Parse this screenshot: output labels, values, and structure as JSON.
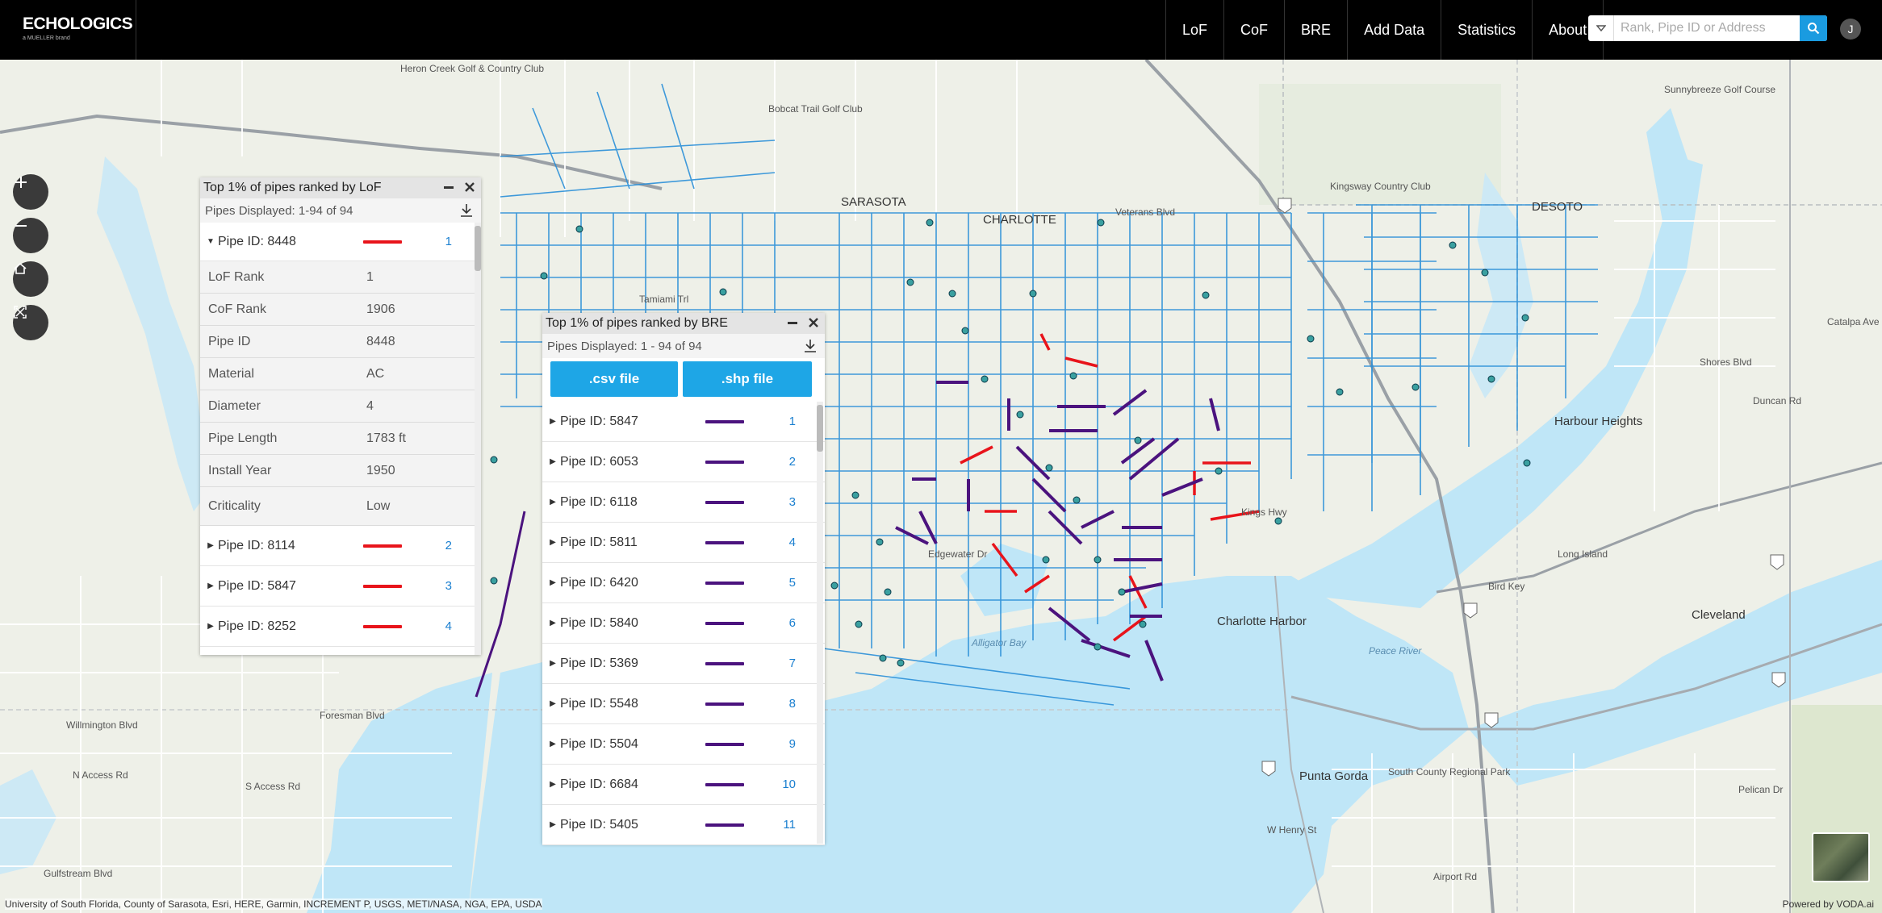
{
  "brand": {
    "name": "ECHOLOGICS",
    "sub": "a MUELLER brand"
  },
  "nav": [
    "LoF",
    "CoF",
    "BRE",
    "Add Data",
    "Statistics",
    "About"
  ],
  "search": {
    "placeholder": "Rank, Pipe ID or Address"
  },
  "user": {
    "initial": "J"
  },
  "map": {
    "labels": [
      {
        "text": "SARASOTA",
        "cls": "city"
      },
      {
        "text": "CHARLOTTE",
        "cls": "city"
      },
      {
        "text": "DESOTO",
        "cls": "city"
      },
      {
        "text": "Charlotte Harbor",
        "cls": "city"
      },
      {
        "text": "Punta Gorda",
        "cls": "city"
      },
      {
        "text": "Harbour Heights",
        "cls": "city"
      },
      {
        "text": "Cleveland",
        "cls": "city"
      },
      {
        "text": "Alligator Bay",
        "cls": "water"
      },
      {
        "text": "Peace River",
        "cls": "water"
      },
      {
        "text": "Bird Key",
        "cls": ""
      },
      {
        "text": "Long Island",
        "cls": ""
      },
      {
        "text": "Heron Creek Golf & Country Club",
        "cls": ""
      },
      {
        "text": "Kingsway Country Club",
        "cls": ""
      },
      {
        "text": "Sunnybreeze Golf Course",
        "cls": ""
      },
      {
        "text": "Bobcat Trail Golf Club",
        "cls": ""
      },
      {
        "text": "South County Regional Park",
        "cls": ""
      },
      {
        "text": "Tamiami Trl",
        "cls": ""
      },
      {
        "text": "Veterans Blvd",
        "cls": ""
      },
      {
        "text": "Duncan Rd",
        "cls": ""
      },
      {
        "text": "Shores Blvd",
        "cls": ""
      },
      {
        "text": "Pelican Dr",
        "cls": ""
      },
      {
        "text": "Airport Rd",
        "cls": ""
      },
      {
        "text": "W Henry St",
        "cls": ""
      },
      {
        "text": "Gulfstream Blvd",
        "cls": ""
      },
      {
        "text": "Willmington Blvd",
        "cls": ""
      },
      {
        "text": "Foresman Blvd",
        "cls": ""
      },
      {
        "text": "S Access Rd",
        "cls": ""
      },
      {
        "text": "N Access Rd",
        "cls": ""
      },
      {
        "text": "Catalpa Ave",
        "cls": ""
      },
      {
        "text": "Kings Hwy",
        "cls": ""
      },
      {
        "text": "Edgewater Dr",
        "cls": ""
      }
    ],
    "attribution": "University of South Florida, County of Sarasota, Esri, HERE, Garmin, INCREMENT P, USGS, METI/NASA, NGA, EPA, USDA",
    "powered": "Powered by VODA.ai"
  },
  "lof_panel": {
    "title": "Top 1% of pipes ranked by LoF",
    "displayed": "Pipes Displayed: 1-94 of 94",
    "expanded": {
      "id_label": "Pipe ID: 8448",
      "rank": "1",
      "details": [
        {
          "k": "LoF Rank",
          "v": "1"
        },
        {
          "k": "CoF Rank",
          "v": "1906"
        },
        {
          "k": "Pipe ID",
          "v": "8448"
        },
        {
          "k": "Material",
          "v": "AC"
        },
        {
          "k": "Diameter",
          "v": "4"
        },
        {
          "k": "Pipe Length",
          "v": "1783 ft"
        },
        {
          "k": "Install Year",
          "v": "1950"
        },
        {
          "k": "Criticality",
          "v": "Low"
        }
      ]
    },
    "rows": [
      {
        "id_label": "Pipe ID: 8114",
        "rank": "2"
      },
      {
        "id_label": "Pipe ID: 5847",
        "rank": "3"
      },
      {
        "id_label": "Pipe ID: 8252",
        "rank": "4"
      }
    ],
    "swatch_color": "#e8141b"
  },
  "bre_panel": {
    "title": "Top 1% of pipes ranked by BRE",
    "displayed": "Pipes Displayed: 1 - 94 of 94",
    "csv_label": ".csv file",
    "shp_label": ".shp file",
    "rows": [
      {
        "id_label": "Pipe ID: 5847",
        "rank": "1"
      },
      {
        "id_label": "Pipe ID: 6053",
        "rank": "2"
      },
      {
        "id_label": "Pipe ID: 6118",
        "rank": "3"
      },
      {
        "id_label": "Pipe ID: 5811",
        "rank": "4"
      },
      {
        "id_label": "Pipe ID: 6420",
        "rank": "5"
      },
      {
        "id_label": "Pipe ID: 5840",
        "rank": "6"
      },
      {
        "id_label": "Pipe ID: 5369",
        "rank": "7"
      },
      {
        "id_label": "Pipe ID: 5548",
        "rank": "8"
      },
      {
        "id_label": "Pipe ID: 5504",
        "rank": "9"
      },
      {
        "id_label": "Pipe ID: 6684",
        "rank": "10"
      },
      {
        "id_label": "Pipe ID: 5405",
        "rank": "11"
      }
    ],
    "swatch_color": "#4b137e"
  },
  "icons": {
    "zoom_in": "plus-icon",
    "zoom_out": "minus-icon",
    "home": "home-icon",
    "fullscreen": "fullscreen-icon",
    "search": "magnifier-icon",
    "download": "download-icon",
    "minimize": "minimize-icon",
    "close": "close-icon",
    "expand": "triangle-right-icon",
    "collapse": "triangle-down-icon"
  },
  "colors": {
    "nav_bg": "#000000",
    "accent": "#1ea6e6",
    "water": "#bfe6f7",
    "pipe": "#2a8fd8",
    "lof_pipe": "#e8141b",
    "bre_pipe": "#4b137e"
  }
}
